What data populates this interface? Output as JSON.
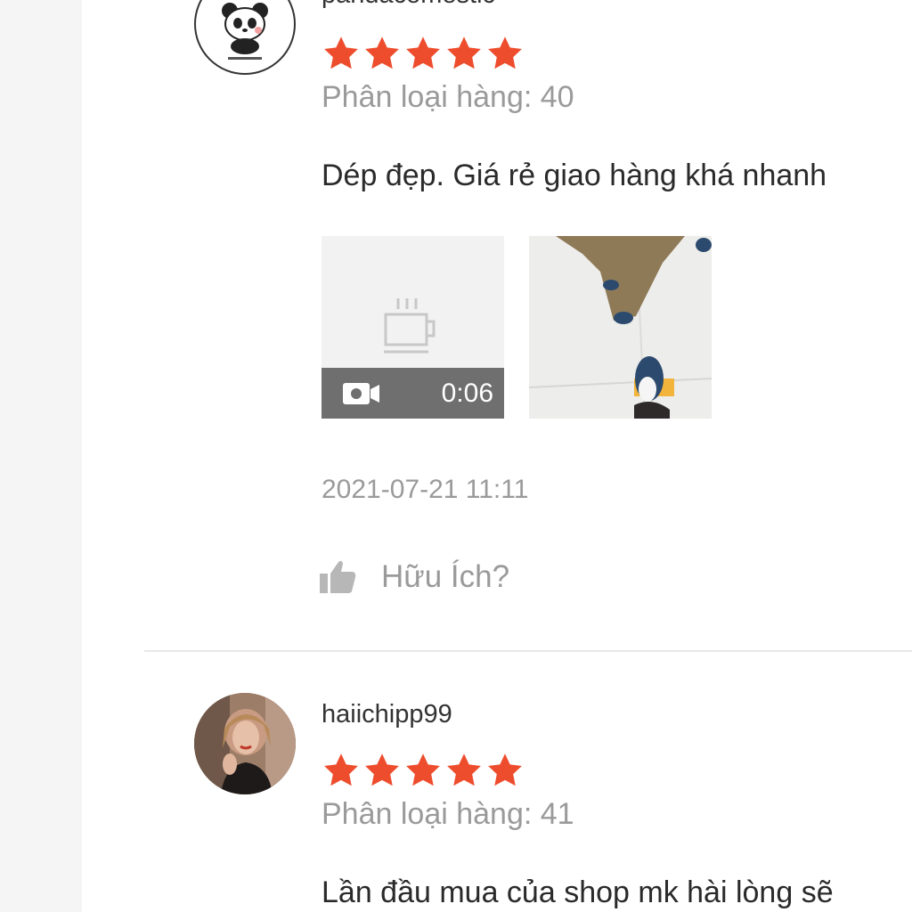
{
  "reviews": [
    {
      "username": "pandacomestic",
      "rating": 5,
      "variant": "Phân loại hàng: 40",
      "comment": "Dép đẹp. Giá rẻ giao hàng khá nhanh",
      "video_duration": "0:06",
      "timestamp": "2021-07-21 11:11",
      "helpful_label": "Hữu Ích?"
    },
    {
      "username": "haiichipp99",
      "rating": 5,
      "variant": "Phân loại hàng: 41",
      "comment": "Lần đầu mua của shop mk hài lòng sẽ"
    }
  ],
  "colors": {
    "star": "#ee4d2d",
    "muted_text": "#9a9a9a",
    "video_bar": "#6f6f6f"
  },
  "icons": [
    "star-icon",
    "coffee-cup-icon",
    "video-camera-icon",
    "thumbs-up-icon"
  ]
}
